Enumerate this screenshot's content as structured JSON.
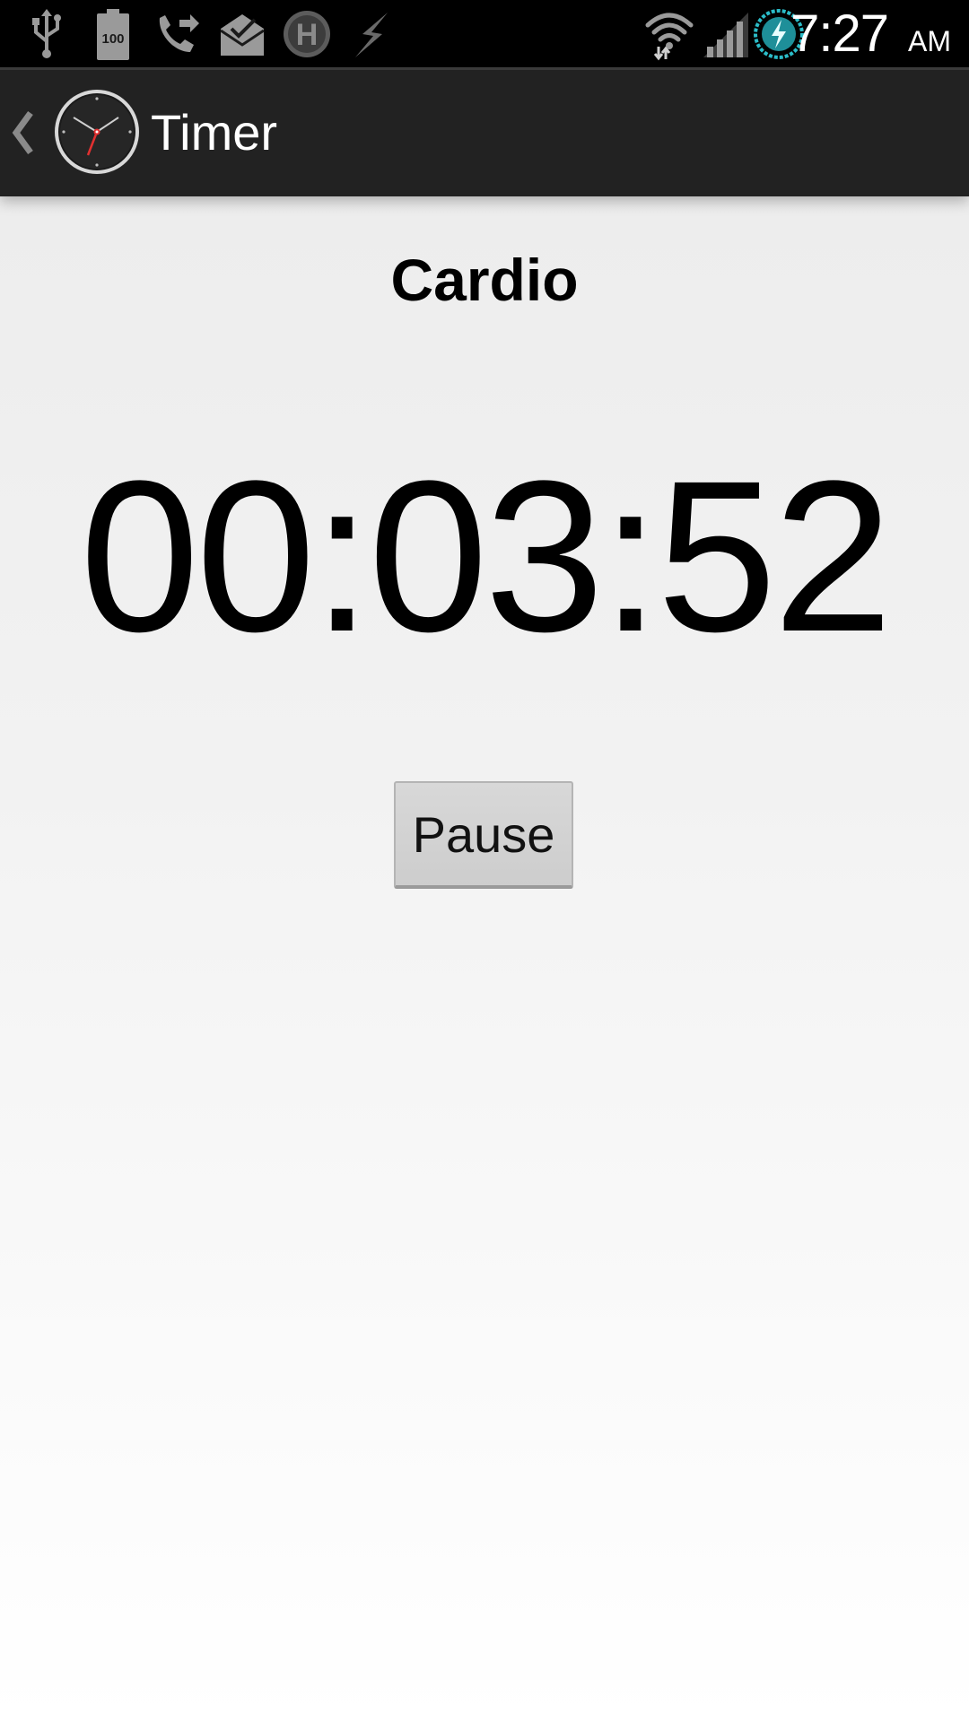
{
  "status_bar": {
    "battery_level": "100",
    "time": "7:27",
    "ampm": "AM",
    "icons": [
      "usb-icon",
      "battery-icon",
      "call-forward-icon",
      "mail-icon",
      "h-icon",
      "flash-icon",
      "wifi-icon",
      "signal-icon",
      "power-icon"
    ]
  },
  "action_bar": {
    "title": "Timer",
    "icons": [
      "back-caret-icon",
      "clock-app-icon"
    ]
  },
  "workout": {
    "name": "Cardio"
  },
  "timer": {
    "display": "00:03:52"
  },
  "controls": {
    "pause_label": "Pause"
  },
  "colors": {
    "status_bar_bg": "#000000",
    "action_bar_bg": "#222222",
    "button_bg": "#d3d3d3",
    "text": "#000000",
    "power_icon_accent": "#2bbcc8",
    "clock_second_hand": "#e23030"
  }
}
